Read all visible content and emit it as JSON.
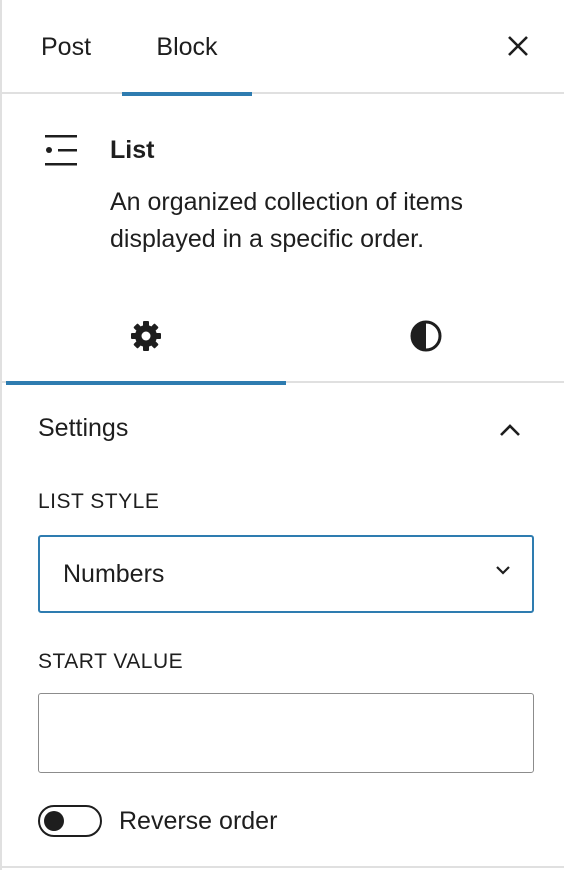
{
  "header": {
    "tabs": [
      {
        "label": "Post"
      },
      {
        "label": "Block"
      }
    ],
    "close_icon": "close-icon"
  },
  "block_card": {
    "icon": "list-icon",
    "title": "List",
    "description": "An organized collection of items displayed in a specific order."
  },
  "inner_tabs": [
    {
      "icon": "gear-icon"
    },
    {
      "icon": "contrast-icon"
    }
  ],
  "settings": {
    "title": "Settings",
    "collapse_icon": "chevron-up-icon",
    "list_style_label": "LIST STYLE",
    "list_style_value": "Numbers",
    "start_value_label": "START VALUE",
    "start_value": "",
    "reverse_order_label": "Reverse order",
    "reverse_order_on": false
  },
  "colors": {
    "accent": "#2e7cb0",
    "text": "#1e1e1e",
    "border": "#e0e0e0"
  }
}
